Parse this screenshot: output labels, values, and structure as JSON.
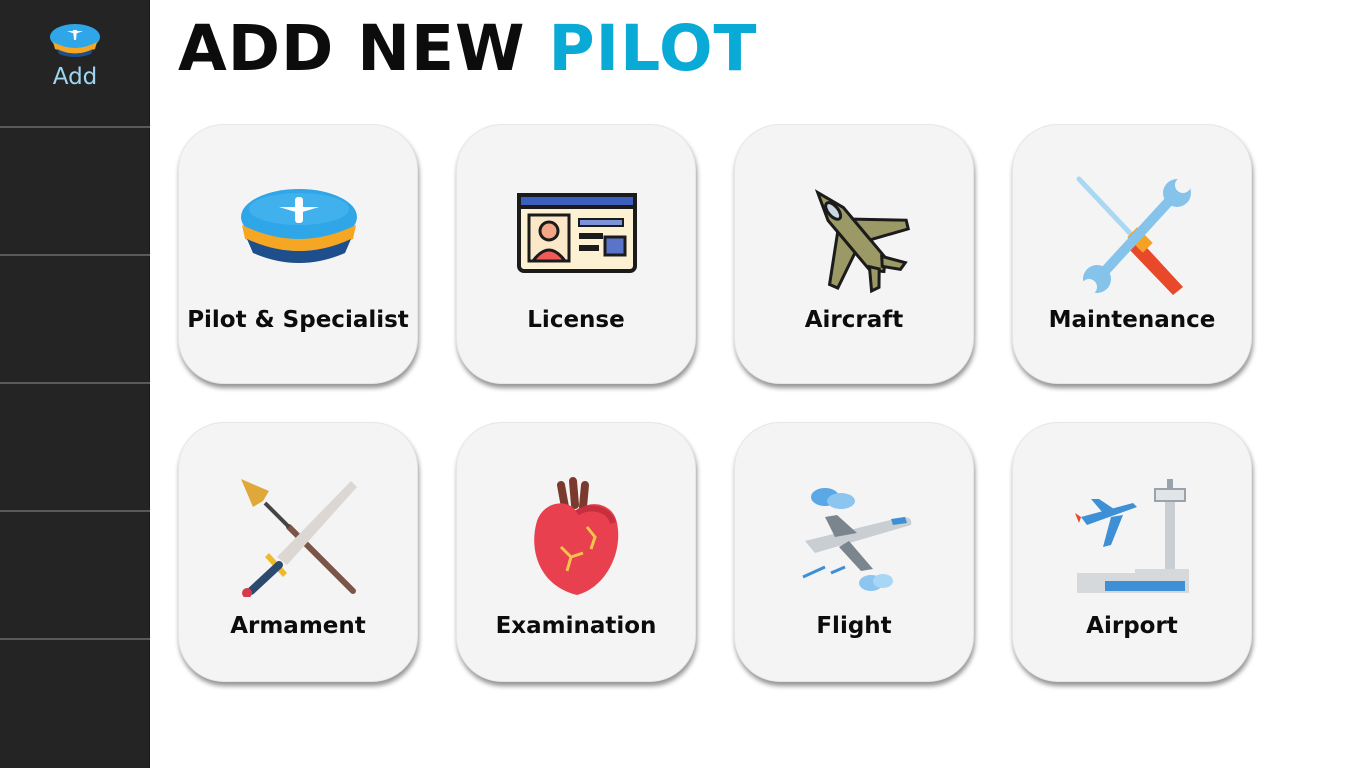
{
  "sidebar": {
    "items": [
      {
        "label": "Add",
        "icon": "pilot-cap-icon"
      }
    ]
  },
  "header": {
    "title_part1": "ADD NEW",
    "title_part2": "PILOT",
    "accent_color": "#0aaad6"
  },
  "tiles": [
    {
      "label": "Pilot & Specialist",
      "icon": "pilot-cap-icon"
    },
    {
      "label": "License",
      "icon": "id-card-icon"
    },
    {
      "label": "Aircraft",
      "icon": "fighter-jet-icon"
    },
    {
      "label": "Maintenance",
      "icon": "tools-icon"
    },
    {
      "label": "Armament",
      "icon": "weapons-icon"
    },
    {
      "label": "Examination",
      "icon": "heart-icon"
    },
    {
      "label": "Flight",
      "icon": "airplane-clouds-icon"
    },
    {
      "label": "Airport",
      "icon": "airport-icon"
    }
  ]
}
